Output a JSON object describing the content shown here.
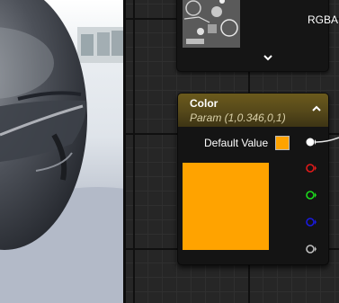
{
  "texture_node": {
    "channel_label": "RGBA"
  },
  "color_node": {
    "title": "Color",
    "subtitle": "Param (1,0.346,0,1)",
    "default_value_label": "Default Value",
    "color_hex": "#ffa300",
    "pins": [
      {
        "name": "output-pin",
        "color": "#ffffff"
      },
      {
        "name": "r-pin",
        "color": "#e01a1a"
      },
      {
        "name": "g-pin",
        "color": "#1ddb1d"
      },
      {
        "name": "b-pin",
        "color": "#1a1ae0"
      },
      {
        "name": "a-pin",
        "color": "#bfbfbf"
      }
    ]
  }
}
